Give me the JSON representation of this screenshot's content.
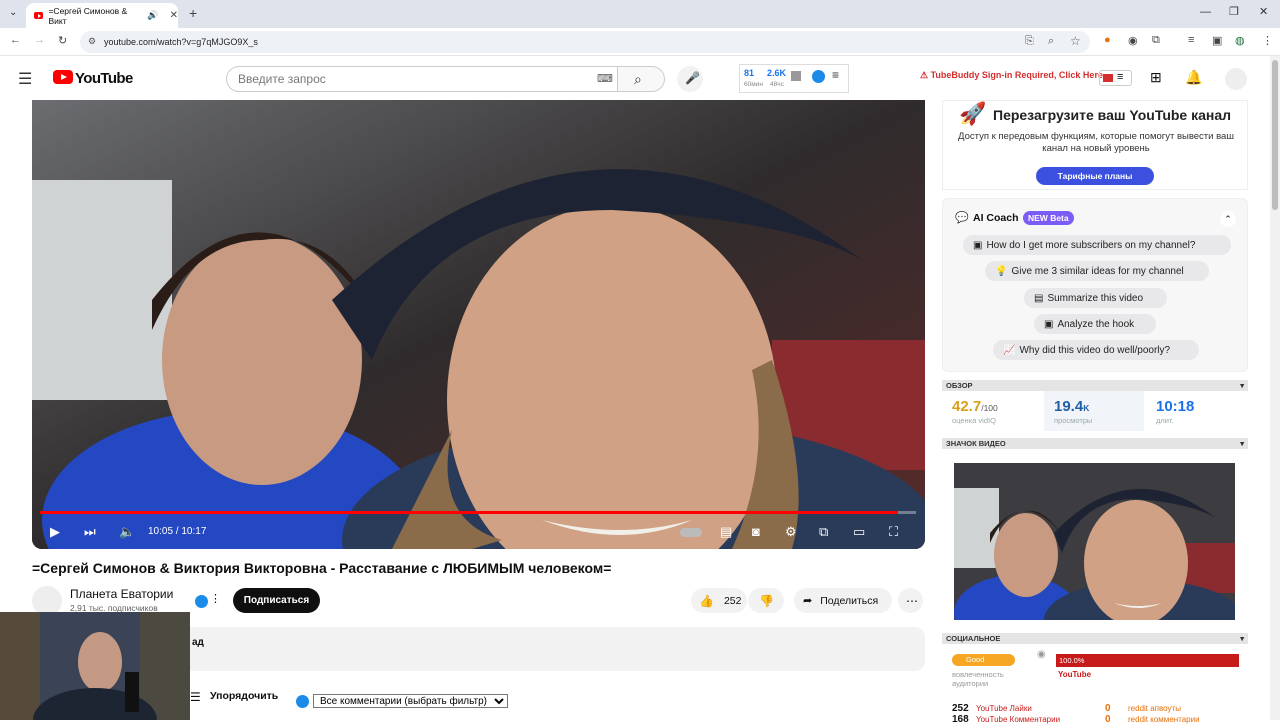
{
  "browser": {
    "tab_title": "=Сергей Симонов & Викт",
    "url": "youtube.com/watch?v=g7qMJGO9X_s"
  },
  "header": {
    "logo_text": "YouTube",
    "search_placeholder": "Введите запрос",
    "stats": {
      "views_hour": "81",
      "views_hour_label": "60мин",
      "views_48": "2.6K",
      "views_48_label": "48чс"
    },
    "tubebuddy_warning": "TubeBuddy Sign-in Required, Click Here"
  },
  "player": {
    "time_current": "10:05",
    "time_total": "10:17",
    "progress_fraction": 0.979
  },
  "video": {
    "title": "=Сергей Симонов & Виктория Викторовна - Расставание с ЛЮБИМЫМ человеком=",
    "channel": "Планета Еватории",
    "subscribers": "2,91 тыс. подписчиков",
    "subscribe_label": "Подписаться",
    "likes": "252",
    "share_label": "Поделиться",
    "desc_snippet": "ад"
  },
  "comments": {
    "sort_label": "Упорядочить",
    "filter_value": "Все комментарии (выбрать фильтр)"
  },
  "tubebuddy": {
    "title": "Перезагрузите ваш YouTube канал",
    "desc": "Доступ к передовым функциям, которые помогут вывести ваш канал на новый уровень",
    "button": "Тарифные планы"
  },
  "ai_coach": {
    "title": "AI Coach",
    "badge": "NEW Beta",
    "questions": [
      "How do I get more subscribers on my channel?",
      "Give me 3 similar ideas for my channel",
      "Summarize this video",
      "Analyze the hook",
      "Why did this video do well/poorly?"
    ]
  },
  "overview": {
    "header": "ОБЗОР",
    "score": "42.7",
    "score_suffix": "/100",
    "score_label": "оценка vidIQ",
    "views": "19.4",
    "views_suffix": "K",
    "views_label": "просмотры",
    "length": "10:18",
    "length_label": "длит."
  },
  "thumbnail_header": "ЗНАЧОК ВИДЕО",
  "social": {
    "header": "СОЦИАЛЬНОЕ",
    "engagement_badge": "Good",
    "engagement_label": "вовлеченность аудитории",
    "youtube_pct": "100.0%",
    "youtube_label": "YouTube",
    "yt_likes_num": "252",
    "yt_likes_label": "YouTube Лайки",
    "yt_comments_num": "168",
    "yt_comments_label": "YouTube Комментарии",
    "reddit_up_num": "0",
    "reddit_up_label": "reddit апвоуты",
    "reddit_comments_num": "0",
    "reddit_comments_label": "reddit комментарии"
  },
  "colors": {
    "yt_red": "#ff0000",
    "tubebuddy_blue": "#3b50df",
    "ai_purple": "#7b5cf5",
    "score_yellow": "#d9a017",
    "vidiq_blue": "#1a73e8"
  }
}
